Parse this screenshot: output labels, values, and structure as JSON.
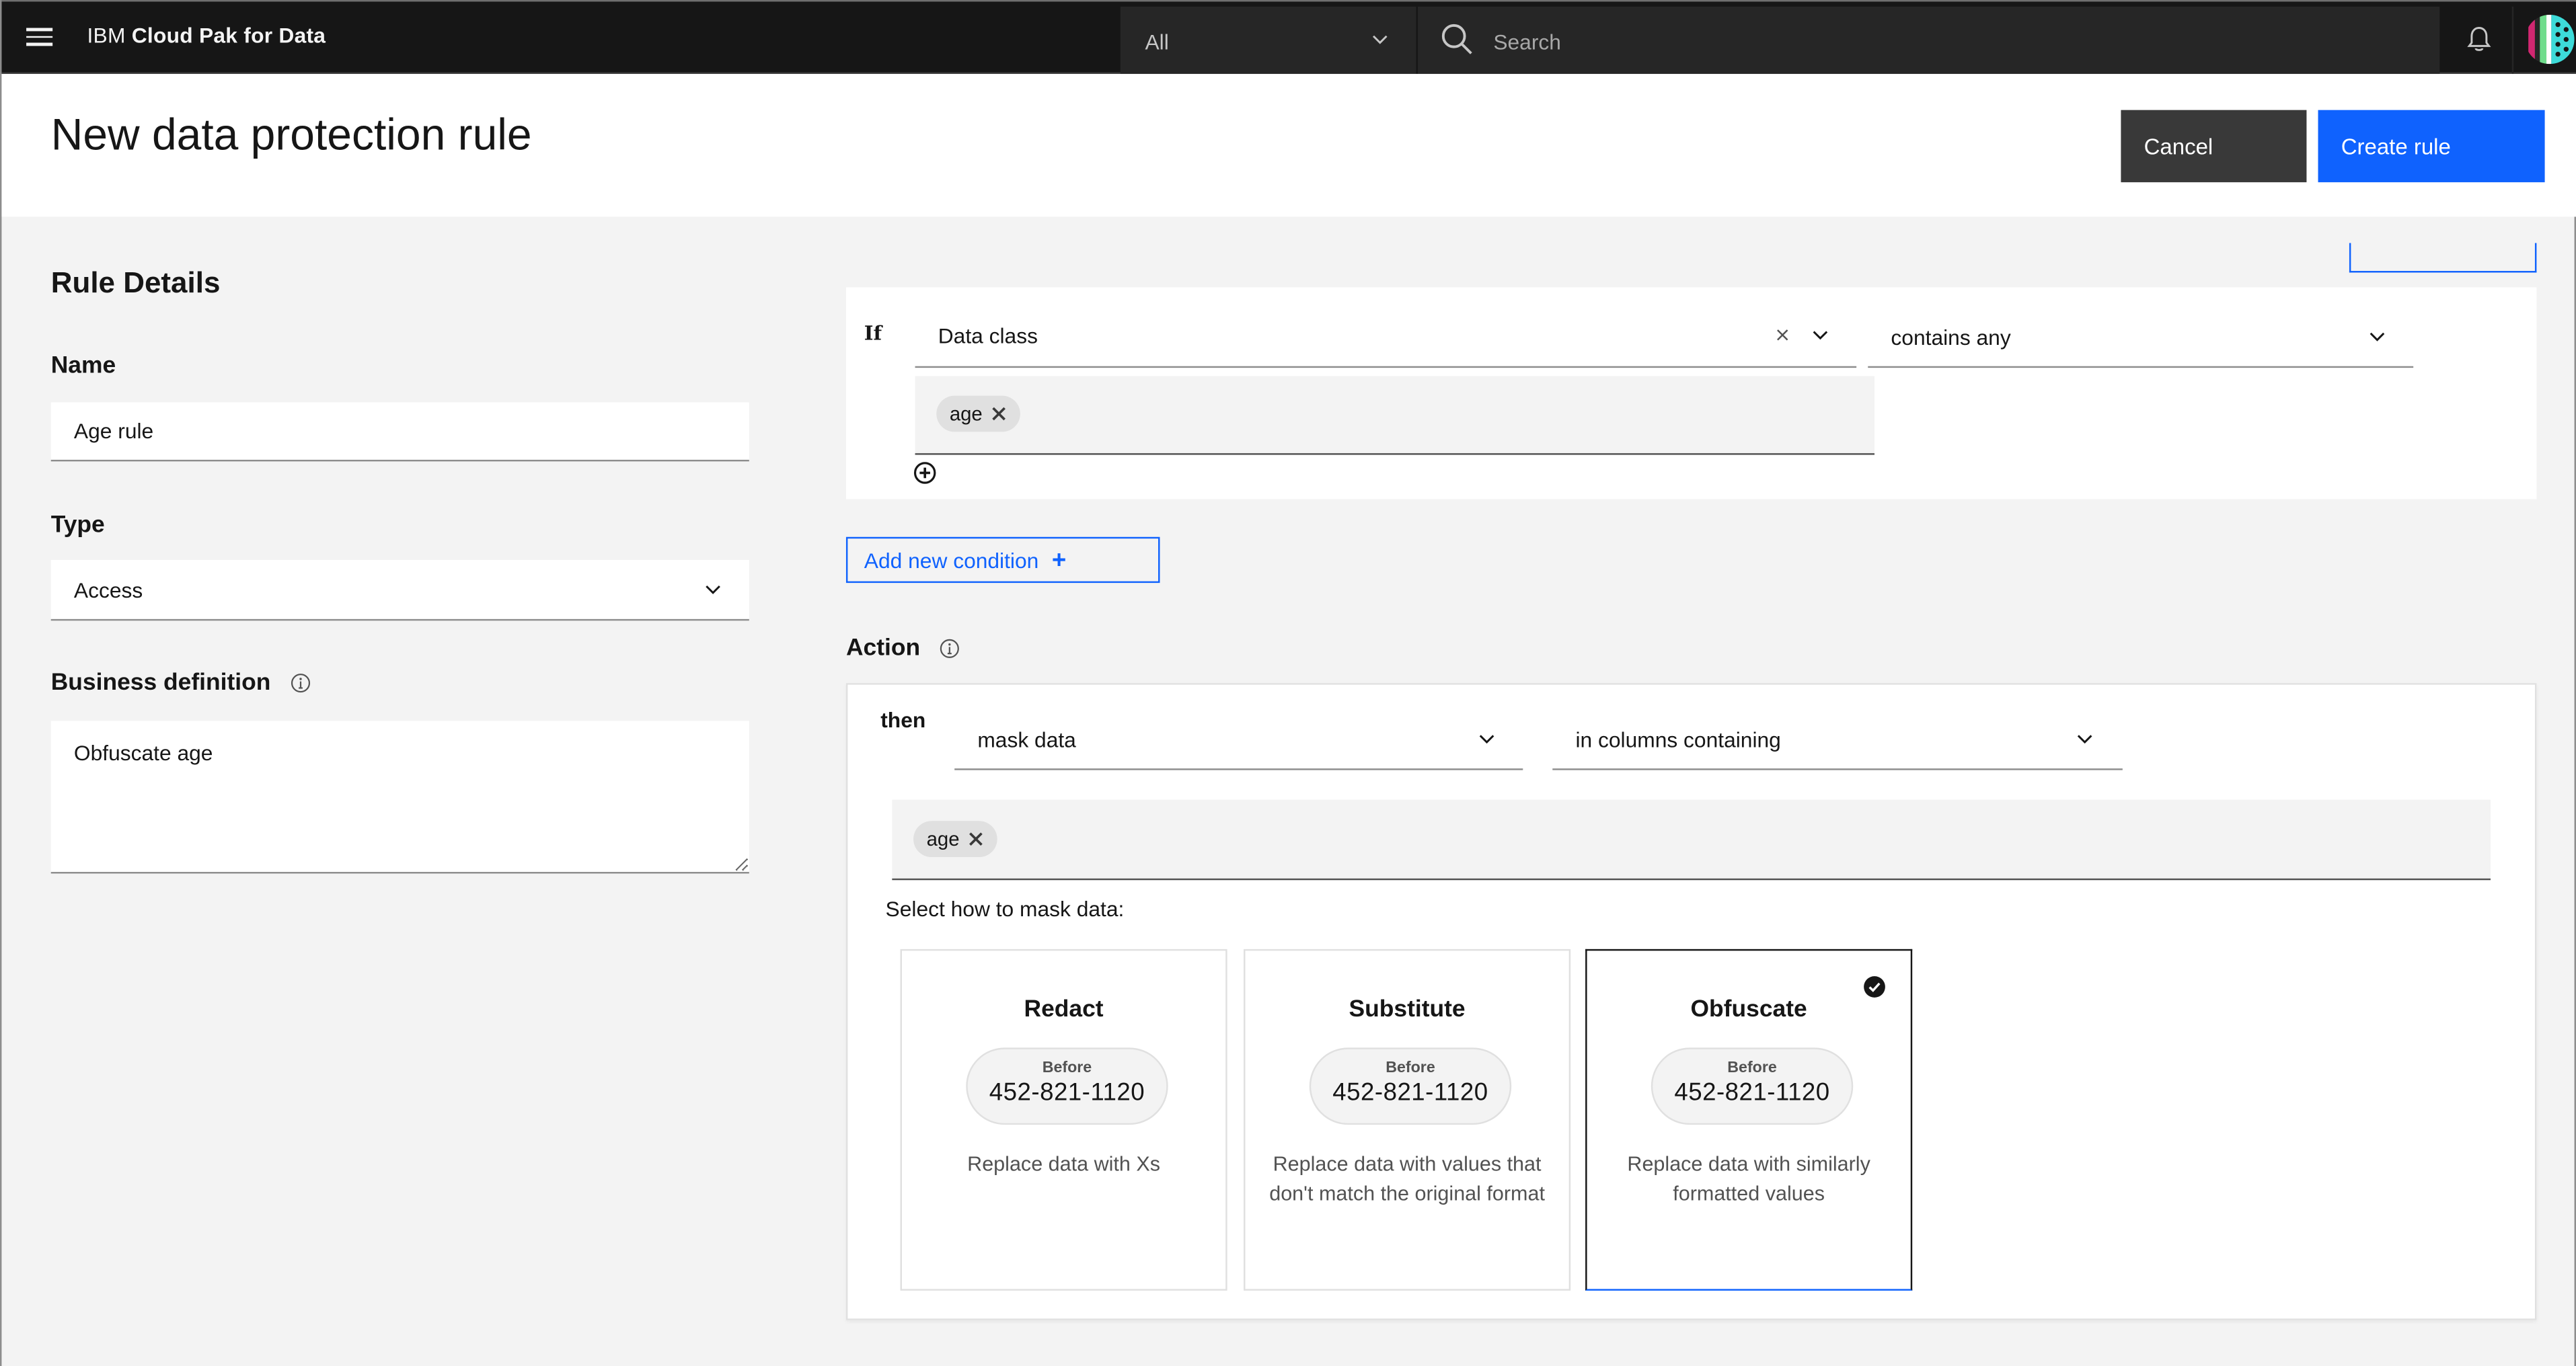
{
  "topbar": {
    "brand_prefix": "IBM",
    "brand_name": "Cloud Pak for Data",
    "scope_value": "All",
    "search_placeholder": "Search",
    "icons": [
      "menu-icon",
      "chevron-down-icon",
      "search-icon",
      "notification-bell-icon",
      "user-avatar"
    ]
  },
  "page": {
    "title": "New data protection rule",
    "cancel_label": "Cancel",
    "create_label": "Create rule"
  },
  "rule_details": {
    "section_title": "Rule Details",
    "name_label": "Name",
    "name_value": "Age rule",
    "type_label": "Type",
    "type_value": "Access",
    "business_definition_label": "Business definition",
    "business_definition_value": "Obfuscate age"
  },
  "condition": {
    "if_label": "If",
    "field_value": "Data class",
    "operator_value": "contains any",
    "tags": [
      "age"
    ],
    "add_condition_label": "Add new condition"
  },
  "action": {
    "title": "Action",
    "then_label": "then",
    "action_value": "mask data",
    "scope_value": "in columns containing",
    "tags": [
      "age"
    ],
    "mask_prompt": "Select how to mask data:",
    "methods": [
      {
        "title": "Redact",
        "before_label": "Before",
        "sample": "452-821-1120",
        "description": "Replace data with Xs",
        "selected": false
      },
      {
        "title": "Substitute",
        "before_label": "Before",
        "sample": "452-821-1120",
        "description": "Replace data with values that don't match the original format",
        "selected": false
      },
      {
        "title": "Obfuscate",
        "before_label": "Before",
        "sample": "452-821-1120",
        "description": "Replace data with similarly formatted values",
        "selected": true
      }
    ]
  },
  "colors": {
    "primary": "#0f62fe",
    "topbar_bg": "#161616",
    "secondary_button": "#393939",
    "page_bg": "#f3f3f3"
  }
}
